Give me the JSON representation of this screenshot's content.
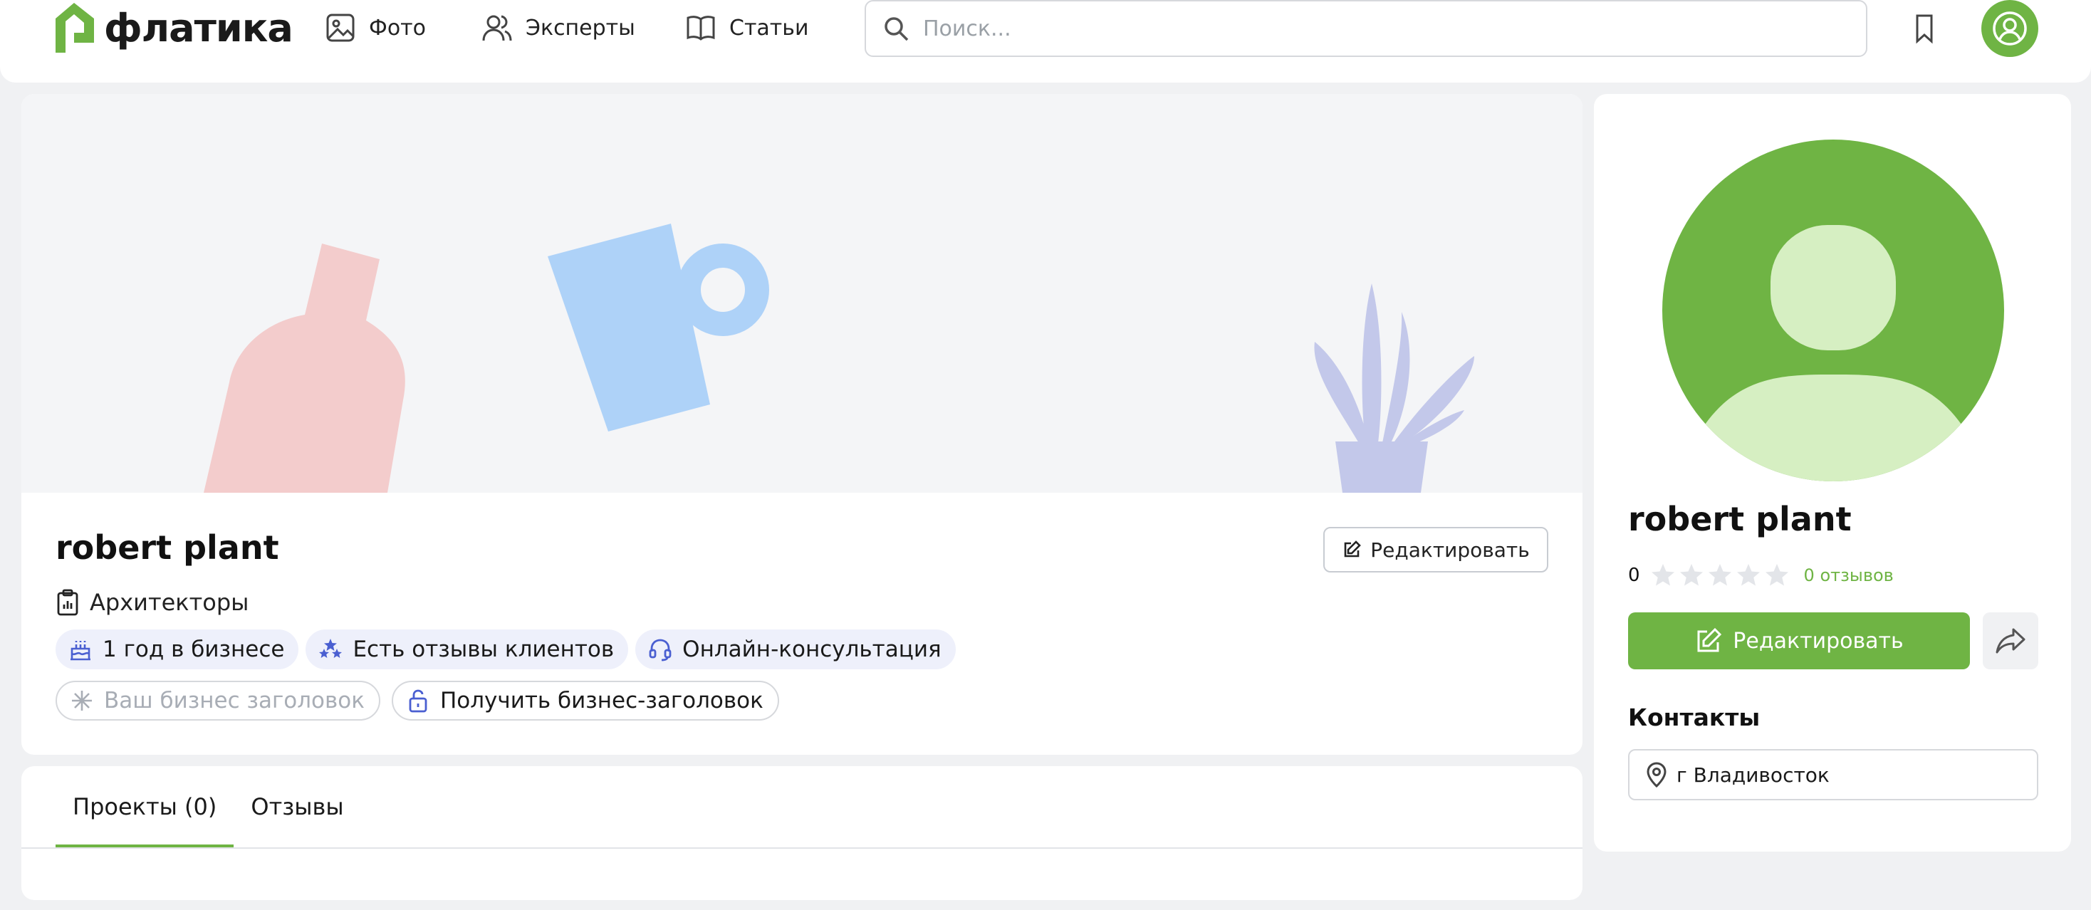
{
  "header": {
    "logo_text": "флатика",
    "nav": [
      {
        "label": "Фото",
        "icon": "image-icon"
      },
      {
        "label": "Эксперты",
        "icon": "users-icon"
      },
      {
        "label": "Статьи",
        "icon": "book-icon"
      }
    ],
    "search_placeholder": "Поиск..."
  },
  "profile": {
    "name": "robert plant",
    "edit_label": "Редактировать",
    "category": "Архитекторы",
    "badges": [
      {
        "label": "1 год в бизнесе",
        "icon": "cake-icon"
      },
      {
        "label": "Есть отзывы клиентов",
        "icon": "stars-group-icon"
      },
      {
        "label": "Онлайн-консультация",
        "icon": "headset-icon"
      }
    ],
    "badges_secondary": [
      {
        "label": "Ваш бизнес заголовок",
        "icon": "sparkle-icon"
      },
      {
        "label": "Получить бизнес-заголовок",
        "icon": "unlock-icon"
      }
    ]
  },
  "tabs": [
    {
      "label": "Проекты (0)",
      "active": true
    },
    {
      "label": "Отзывы",
      "active": false
    }
  ],
  "sidebar": {
    "name": "robert plant",
    "rating": "0",
    "stars_filled": 0,
    "stars_total": 5,
    "reviews_label": "0 отзывов",
    "edit_label": "Редактировать",
    "contacts_title": "Контакты",
    "location": "г Владивосток"
  },
  "colors": {
    "brand_green": "#6fb444",
    "avatar_light": "#d6efc2",
    "badge_bg": "#eef0fb",
    "icon_blue": "#4a5fd1"
  }
}
